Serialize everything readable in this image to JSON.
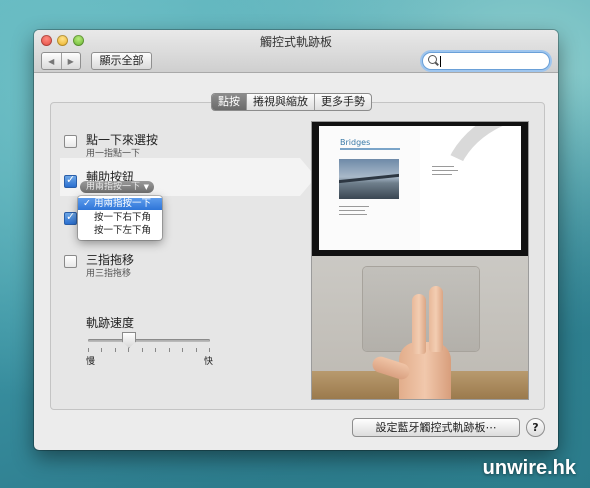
{
  "window": {
    "title": "觸控式軌跡板",
    "nav_back": "◀",
    "nav_forward": "▶",
    "show_all_label": "顯示全部",
    "search": {
      "value": "",
      "placeholder": ""
    }
  },
  "tabs": [
    {
      "label": "點按",
      "active": true
    },
    {
      "label": "捲視與縮放",
      "active": false
    },
    {
      "label": "更多手勢",
      "active": false
    }
  ],
  "options": {
    "tap_to_click": {
      "title": "點一下來選按",
      "subtitle": "用一指點一下",
      "checked": false
    },
    "secondary_click": {
      "title": "輔助按鈕",
      "popup_value": "用兩指按一下",
      "checked": true
    },
    "third_option": {
      "checked": true
    },
    "three_finger_drag": {
      "title": "三指拖移",
      "subtitle": "用三指拖移",
      "checked": false
    }
  },
  "secondary_menu": {
    "items": [
      {
        "label": "用兩指按一下",
        "selected": true
      },
      {
        "label": "按一下右下角",
        "selected": false
      },
      {
        "label": "按一下左下角",
        "selected": false
      }
    ],
    "check_glyph": "✓"
  },
  "tracking_speed": {
    "label": "軌跡速度",
    "min_label": "慢",
    "max_label": "快",
    "value_fraction": 0.33
  },
  "preview": {
    "book_title": "Bridges"
  },
  "footer": {
    "bluetooth_button": "設定藍牙觸控式軌跡板⋯",
    "help_label": "?"
  },
  "watermark": "unwire.hk",
  "colors": {
    "accent": "#2e75d8",
    "tab_active": "#7a7a7a"
  }
}
